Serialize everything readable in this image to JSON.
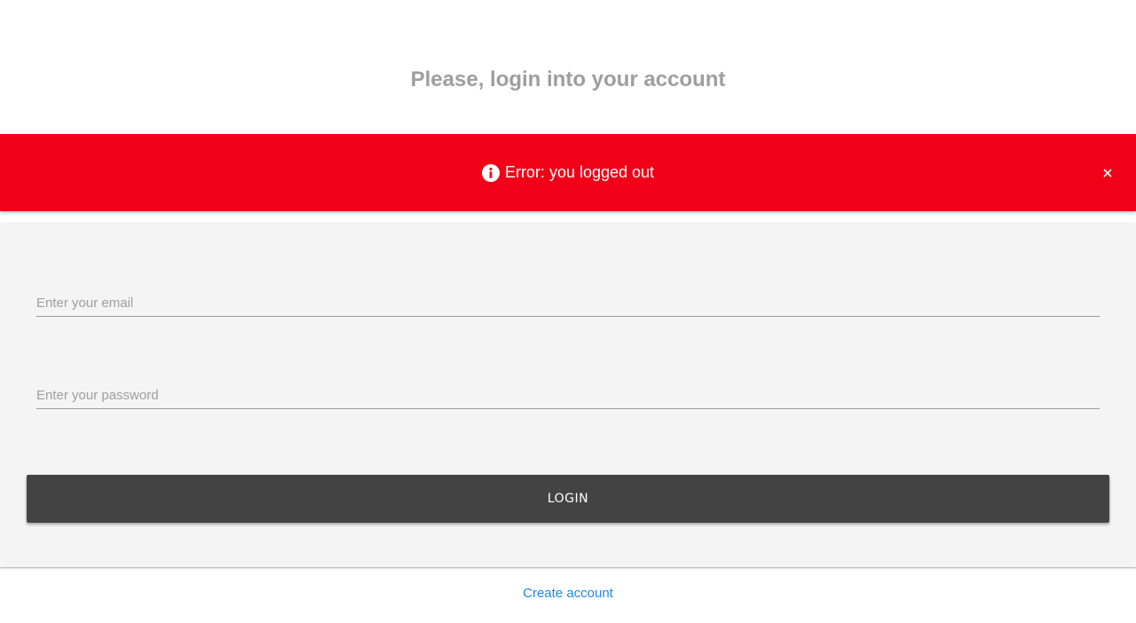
{
  "header": {
    "title": "Please, login into your account"
  },
  "alert": {
    "icon": "info-icon",
    "message": "Error: you logged out",
    "close_icon": "close-icon",
    "background_color": "#f20017"
  },
  "form": {
    "email": {
      "placeholder": "Enter your email",
      "value": ""
    },
    "password": {
      "placeholder": "Enter your password",
      "value": ""
    },
    "login_label": "LOGIN",
    "login_button_color": "#434343"
  },
  "footer": {
    "create_account_label": "Create account",
    "link_color": "#1e88e5"
  }
}
